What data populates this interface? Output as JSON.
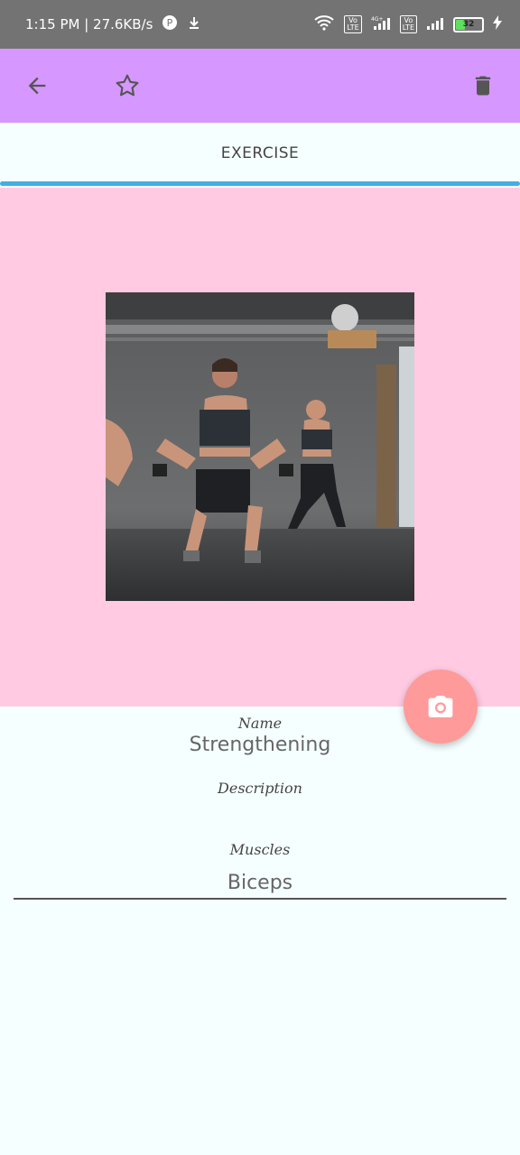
{
  "status_bar": {
    "time_speed": "1:15 PM | 27.6KB/s",
    "battery": "32",
    "network_tag": "4G+",
    "volte_label": "Vo LTE"
  },
  "app_bar": {
    "icons": [
      "back-arrow-icon",
      "star-outline-icon",
      "trash-icon"
    ],
    "color": "#d697ff"
  },
  "tab": {
    "label": "EXERCISE",
    "indicator_color": "#3fb0e4"
  },
  "photo_panel": {
    "background": "#ffcae2"
  },
  "fab": {
    "icon": "camera-icon",
    "color": "#ff9a9a"
  },
  "form": {
    "name_label": "Name",
    "name_value": "Strengthening",
    "description_label": "Description",
    "description_value": "",
    "muscles_label": "Muscles",
    "muscles_value": "Biceps"
  }
}
